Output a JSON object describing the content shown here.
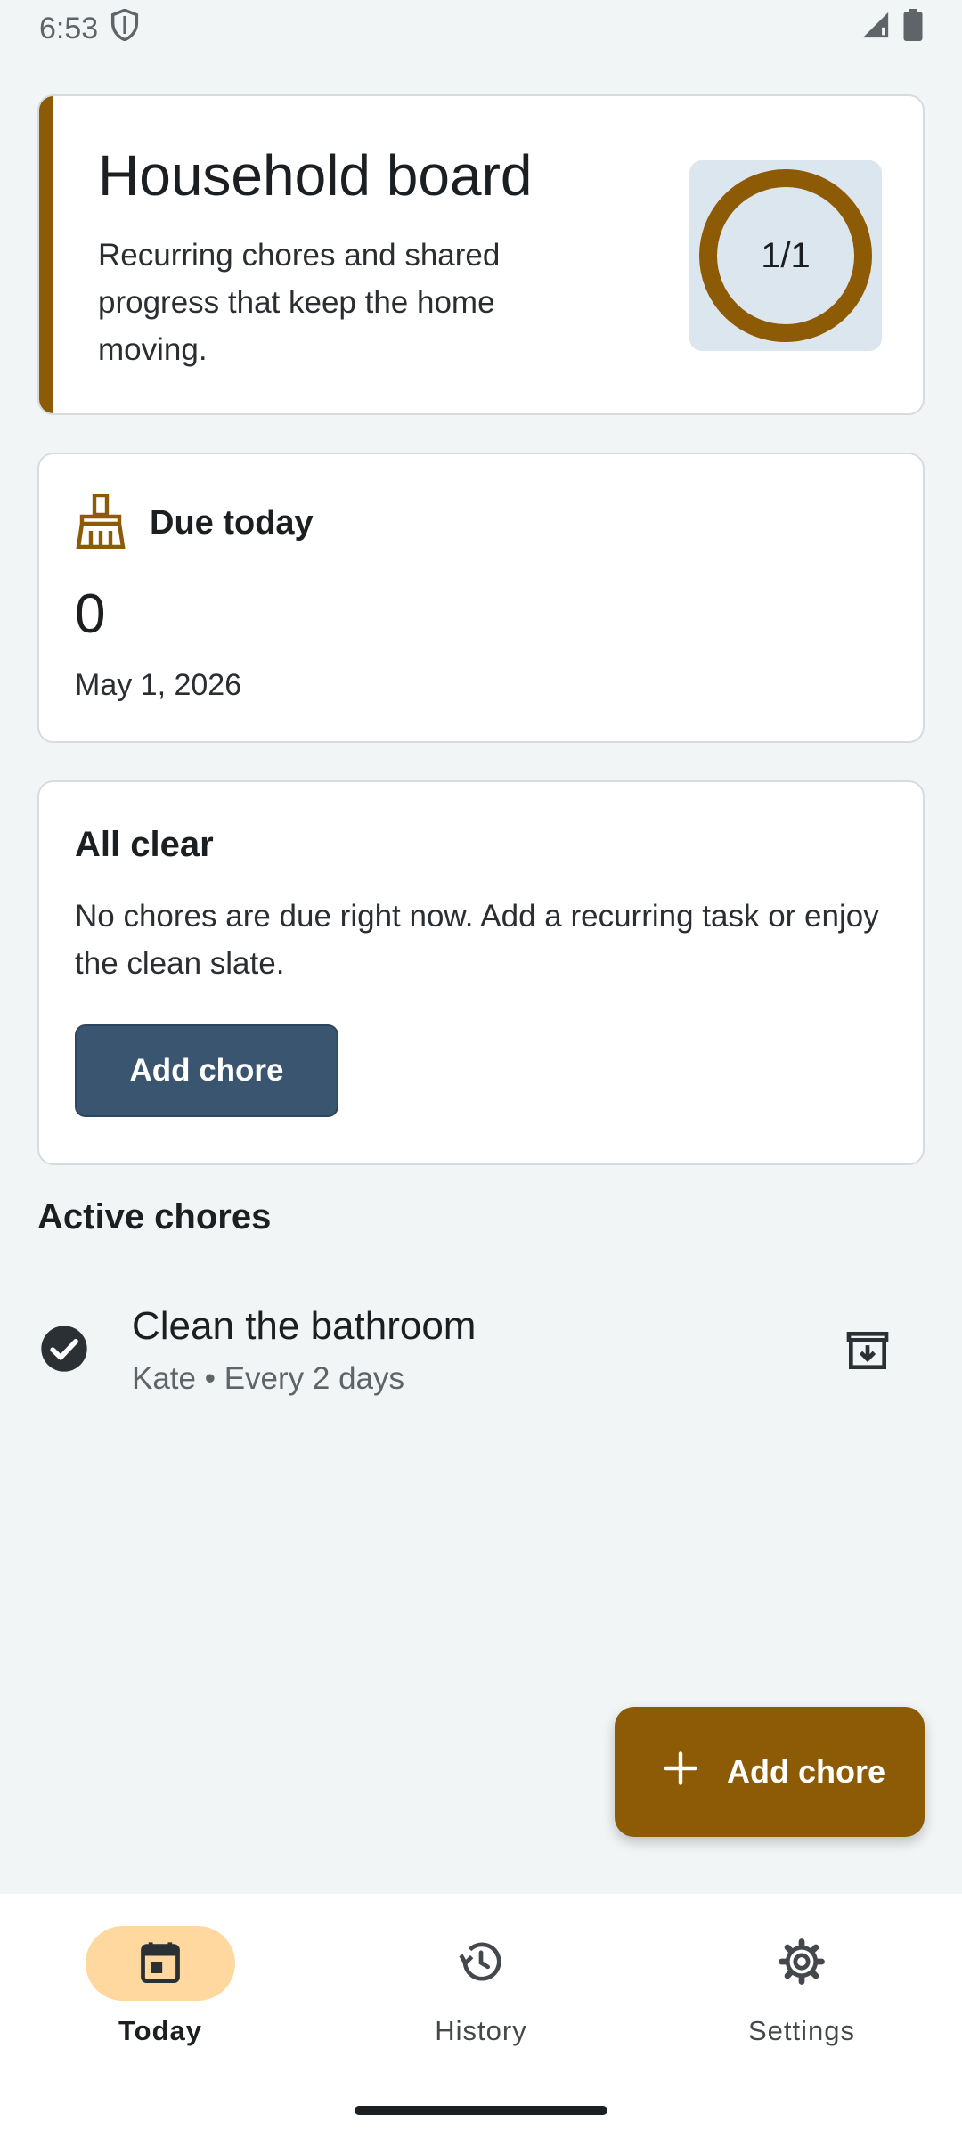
{
  "status_bar": {
    "time": "6:53"
  },
  "board": {
    "title": "Household board",
    "subtitle": "Recurring chores and shared progress that keep the home moving.",
    "progress_label": "1/1",
    "progress_fraction": 1.0,
    "accent_color": "#8d5a05"
  },
  "due_today": {
    "title": "Due today",
    "count": "0",
    "date": "May 1, 2026",
    "icon": "broom-icon"
  },
  "all_clear": {
    "title": "All clear",
    "body": "No chores are due right now. Add a recurring task or enjoy the clean slate.",
    "button_label": "Add chore"
  },
  "active_chores": {
    "title": "Active chores",
    "items": [
      {
        "name": "Clean the bathroom",
        "meta": "Kate • Every 2 days",
        "done": true
      }
    ]
  },
  "fab": {
    "label": "Add chore"
  },
  "nav": {
    "items": [
      {
        "label": "Today",
        "icon": "calendar-icon",
        "active": true
      },
      {
        "label": "History",
        "icon": "history-icon",
        "active": false
      },
      {
        "label": "Settings",
        "icon": "gear-icon",
        "active": false
      }
    ]
  },
  "colors": {
    "primary": "#8d5a05",
    "button": "#3a556f",
    "nav_active": "#ffd8a0",
    "progress_bg": "#dce6ef"
  }
}
